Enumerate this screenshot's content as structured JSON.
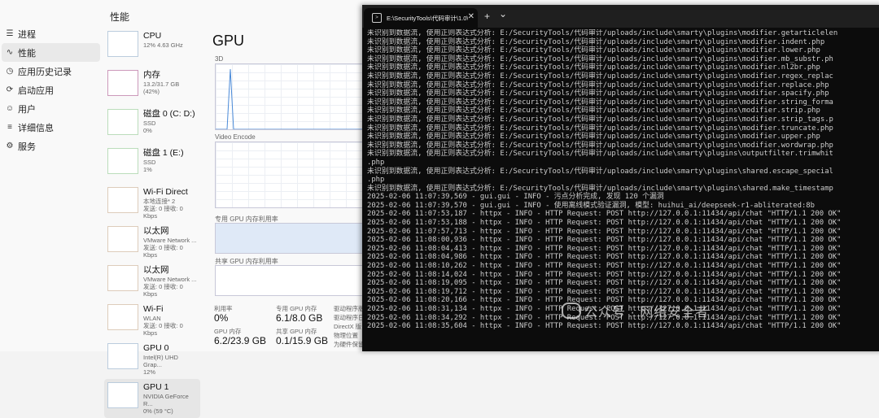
{
  "taskmgr": {
    "section_title": "性能",
    "nav": [
      {
        "label": "进程",
        "icon": "processes-icon"
      },
      {
        "label": "性能",
        "icon": "performance-icon"
      },
      {
        "label": "应用历史记录",
        "icon": "app-history-icon"
      },
      {
        "label": "启动应用",
        "icon": "startup-icon"
      },
      {
        "label": "用户",
        "icon": "users-icon"
      },
      {
        "label": "详细信息",
        "icon": "details-icon"
      },
      {
        "label": "服务",
        "icon": "services-icon"
      }
    ],
    "devices": [
      {
        "name": "CPU",
        "line1": "12%  4.63 GHz",
        "line2": ""
      },
      {
        "name": "内存",
        "line1": "13.2/31.7 GB (42%)",
        "line2": ""
      },
      {
        "name": "磁盘 0 (C: D:)",
        "line1": "SSD",
        "line2": "0%"
      },
      {
        "name": "磁盘 1 (E:)",
        "line1": "SSD",
        "line2": "1%"
      },
      {
        "name": "Wi-Fi Direct",
        "line1": "本地连接* 2",
        "line2": "发送: 0 接收: 0 Kbps"
      },
      {
        "name": "以太网",
        "line1": "VMware Network ...",
        "line2": "发送: 0 接收: 0 Kbps"
      },
      {
        "name": "以太网",
        "line1": "VMware Network ...",
        "line2": "发送: 0 接收: 0 Kbps"
      },
      {
        "name": "Wi-Fi",
        "line1": "WLAN",
        "line2": "发送: 0 接收: 0 Kbps"
      },
      {
        "name": "GPU 0",
        "line1": "Intel(R) UHD Grap...",
        "line2": "12%"
      },
      {
        "name": "GPU 1",
        "line1": "NVIDIA GeForce R...",
        "line2": "0% (59 °C)"
      }
    ],
    "main": {
      "title": "GPU",
      "graph_3d": "3D",
      "graph_video": "Video Encode",
      "dedicated_label": "专用 GPU 内存利用率",
      "shared_label": "共享 GPU 内存利用率",
      "util_label": "利用率",
      "util_value": "0%",
      "dedicated_mem_label": "专用 GPU 内存",
      "dedicated_mem_value": "6.1/8.0 GB",
      "gpu_mem_label": "GPU 内存",
      "gpu_mem_value": "6.2/23.9 GB",
      "shared_mem_label": "共享 GPU 内存",
      "shared_mem_value": "0.1/15.9 GB",
      "driver_labels": [
        "驱动程序版",
        "驱动程序日",
        "DirectX 版",
        "物理位置",
        "为硬件保留"
      ]
    }
  },
  "terminal": {
    "tab_title": "E:\\SecurityTools\\代码审计\\1.0\\",
    "new_tab": "+",
    "dropdown": "⌄",
    "lines": [
      "未识别到数据流, 使用正则表达式分析: E:/SecurityTools/代码审计/uploads/include\\smarty\\plugins\\modifier.getarticlelen",
      "未识别到数据流, 使用正则表达式分析: E:/SecurityTools/代码审计/uploads/include\\smarty\\plugins\\modifier.indent.php",
      "未识别到数据流, 使用正则表达式分析: E:/SecurityTools/代码审计/uploads/include\\smarty\\plugins\\modifier.lower.php",
      "未识别到数据流, 使用正则表达式分析: E:/SecurityTools/代码审计/uploads/include\\smarty\\plugins\\modifier.mb_substr.ph",
      "未识别到数据流, 使用正则表达式分析: E:/SecurityTools/代码审计/uploads/include\\smarty\\plugins\\modifier.nl2br.php",
      "未识别到数据流, 使用正则表达式分析: E:/SecurityTools/代码审计/uploads/include\\smarty\\plugins\\modifier.regex_replac",
      "未识别到数据流, 使用正则表达式分析: E:/SecurityTools/代码审计/uploads/include\\smarty\\plugins\\modifier.replace.php",
      "未识别到数据流, 使用正则表达式分析: E:/SecurityTools/代码审计/uploads/include\\smarty\\plugins\\modifier.spacify.php",
      "未识别到数据流, 使用正则表达式分析: E:/SecurityTools/代码审计/uploads/include\\smarty\\plugins\\modifier.string_forma",
      "未识别到数据流, 使用正则表达式分析: E:/SecurityTools/代码审计/uploads/include\\smarty\\plugins\\modifier.strip.php",
      "未识别到数据流, 使用正则表达式分析: E:/SecurityTools/代码审计/uploads/include\\smarty\\plugins\\modifier.strip_tags.p",
      "未识别到数据流, 使用正则表达式分析: E:/SecurityTools/代码审计/uploads/include\\smarty\\plugins\\modifier.truncate.php",
      "未识别到数据流, 使用正则表达式分析: E:/SecurityTools/代码审计/uploads/include\\smarty\\plugins\\modifier.upper.php",
      "未识别到数据流, 使用正则表达式分析: E:/SecurityTools/代码审计/uploads/include\\smarty\\plugins\\modifier.wordwrap.php",
      "未识别到数据流, 使用正则表达式分析: E:/SecurityTools/代码审计/uploads/include\\smarty\\plugins\\outputfilter.trimwhit",
      ".php",
      "未识别到数据流, 使用正则表达式分析: E:/SecurityTools/代码审计/uploads/include\\smarty\\plugins\\shared.escape_special",
      ".php",
      "未识别到数据流, 使用正则表达式分析: E:/SecurityTools/代码审计/uploads/include\\smarty\\plugins\\shared.make_timestamp",
      "2025-02-06 11:07:39,569 - gui.gui - INFO - 污点分析完成, 发现 120 个漏洞",
      "2025-02-06 11:07:39,570 - gui.gui - INFO - 使用离线模式验证漏洞, 模型: huihui_ai/deepseek-r1-abliterated:8b",
      "2025-02-06 11:07:53,187 - httpx - INFO - HTTP Request: POST http://127.0.0.1:11434/api/chat \"HTTP/1.1 200 OK\"",
      "2025-02-06 11:07:53,188 - httpx - INFO - HTTP Request: POST http://127.0.0.1:11434/api/chat \"HTTP/1.1 200 OK\"",
      "2025-02-06 11:07:57,713 - httpx - INFO - HTTP Request: POST http://127.0.0.1:11434/api/chat \"HTTP/1.1 200 OK\"",
      "2025-02-06 11:08:00,936 - httpx - INFO - HTTP Request: POST http://127.0.0.1:11434/api/chat \"HTTP/1.1 200 OK\"",
      "2025-02-06 11:08:04,413 - httpx - INFO - HTTP Request: POST http://127.0.0.1:11434/api/chat \"HTTP/1.1 200 OK\"",
      "2025-02-06 11:08:04,986 - httpx - INFO - HTTP Request: POST http://127.0.0.1:11434/api/chat \"HTTP/1.1 200 OK\"",
      "2025-02-06 11:08:10,262 - httpx - INFO - HTTP Request: POST http://127.0.0.1:11434/api/chat \"HTTP/1.1 200 OK\"",
      "2025-02-06 11:08:14,024 - httpx - INFO - HTTP Request: POST http://127.0.0.1:11434/api/chat \"HTTP/1.1 200 OK\"",
      "2025-02-06 11:08:19,095 - httpx - INFO - HTTP Request: POST http://127.0.0.1:11434/api/chat \"HTTP/1.1 200 OK\"",
      "2025-02-06 11:08:19,712 - httpx - INFO - HTTP Request: POST http://127.0.0.1:11434/api/chat \"HTTP/1.1 200 OK\"",
      "2025-02-06 11:08:20,166 - httpx - INFO - HTTP Request: POST http://127.0.0.1:11434/api/chat \"HTTP/1.1 200 OK\"",
      "2025-02-06 11:08:31,134 - httpx - INFO - HTTP Request: POST http://127.0.0.1:11434/api/chat \"HTTP/1.1 200 OK\"",
      "2025-02-06 11:08:34,292 - httpx - INFO - HTTP Request: POST http://127.0.0.1:11434/api/chat \"HTTP/1.1 200 OK\"",
      "2025-02-06 11:08:35,604 - httpx - INFO - HTTP Request: POST http://127.0.0.1:11434/api/chat \"HTTP/1.1 200 OK\""
    ]
  },
  "watermark": "公众号 · 网络安全者"
}
